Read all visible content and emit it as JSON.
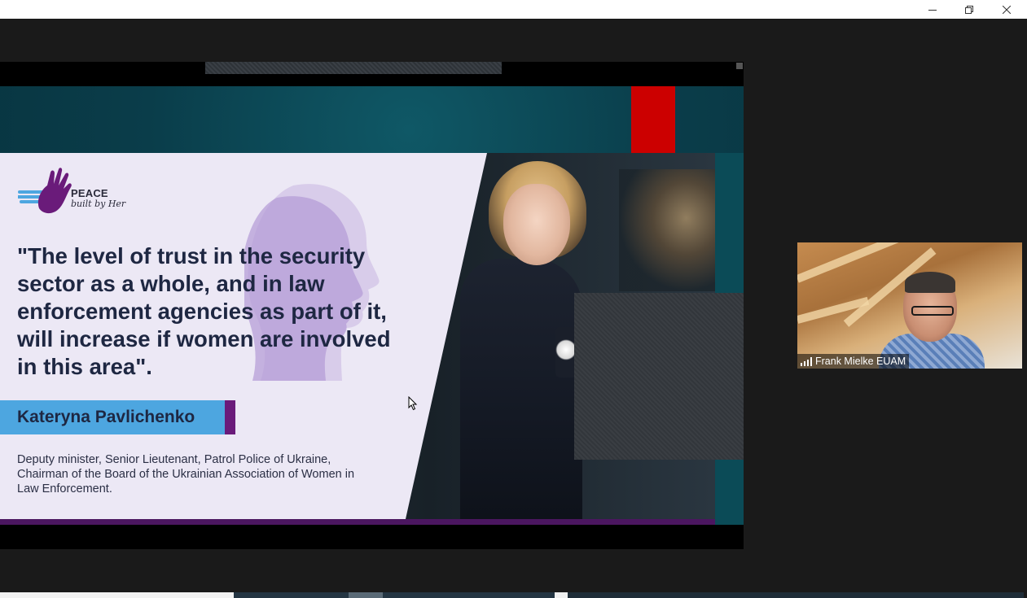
{
  "window": {
    "controls": {
      "minimize_icon": "minimize-icon",
      "restore_icon": "restore-icon",
      "close_icon": "close-icon"
    }
  },
  "slide": {
    "logo_line1": "PEACE",
    "logo_line2": "built by Her",
    "quote": "\"The level of trust in the security sector as a whole, and in law enforcement agencies as part of it, will increase if women are involved in this area\".",
    "speaker_name": "Kateryna Pavlichenko",
    "speaker_description": "Deputy minister, Senior Lieutenant, Patrol Police of Ukraine, Chairman of the Board of the Ukrainian Association of Women in Law Enforcement.",
    "colors": {
      "name_bar": "#4da6e0",
      "accent_purple": "#6a1b7a",
      "red_block": "#cc0000",
      "teal_background": "#0a3d4a",
      "card_background": "#ece8f5"
    }
  },
  "participant": {
    "name": "Frank Mielke EUAM",
    "signal_icon": "signal-strength-icon"
  }
}
